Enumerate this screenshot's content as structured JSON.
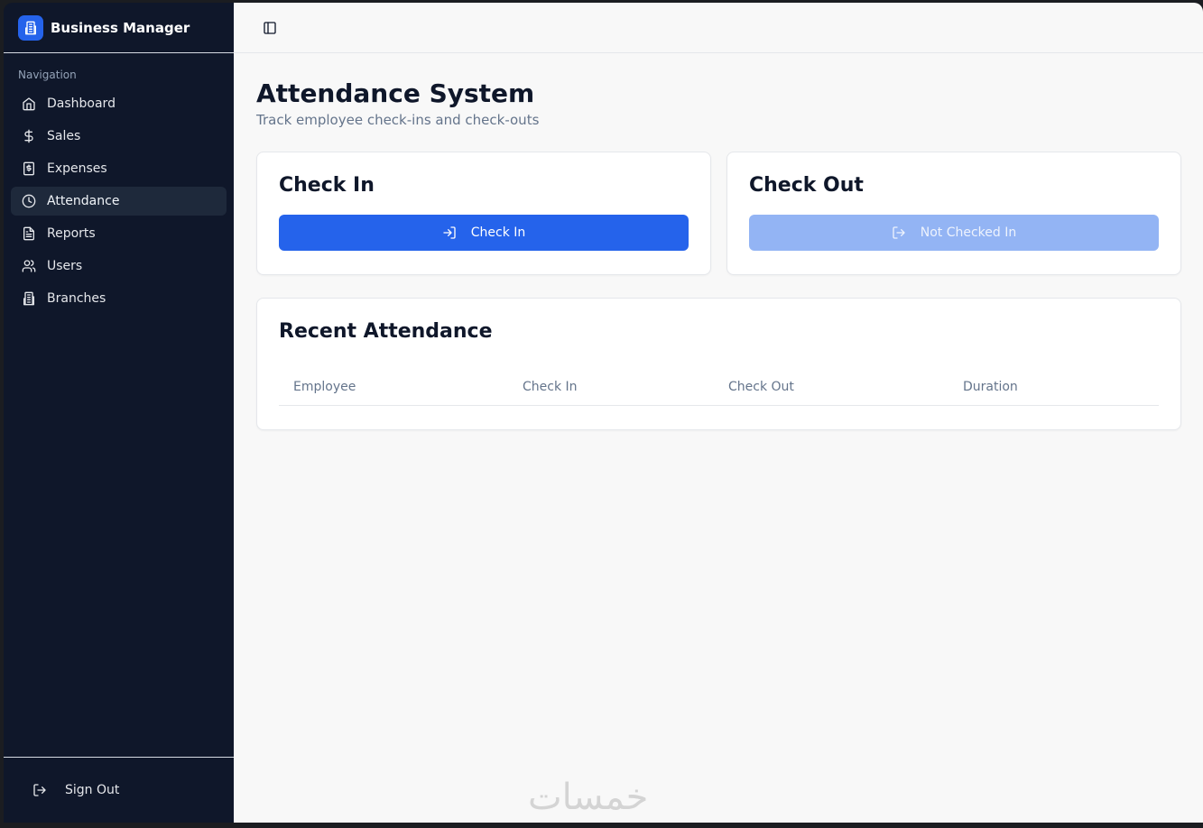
{
  "app": {
    "title": "Business Manager"
  },
  "sidebar": {
    "heading": "Navigation",
    "items": [
      {
        "label": "Dashboard",
        "icon": "home-icon"
      },
      {
        "label": "Sales",
        "icon": "dollar-icon"
      },
      {
        "label": "Expenses",
        "icon": "receipt-icon"
      },
      {
        "label": "Attendance",
        "icon": "clock-icon",
        "active": true
      },
      {
        "label": "Reports",
        "icon": "file-icon"
      },
      {
        "label": "Users",
        "icon": "users-icon"
      },
      {
        "label": "Branches",
        "icon": "building-icon"
      }
    ],
    "signout_label": "Sign Out"
  },
  "page": {
    "title": "Attendance System",
    "subtitle": "Track employee check-ins and check-outs"
  },
  "checkin_card": {
    "title": "Check In",
    "button_label": "Check In"
  },
  "checkout_card": {
    "title": "Check Out",
    "button_label": "Not Checked In"
  },
  "recent": {
    "title": "Recent Attendance",
    "columns": [
      "Employee",
      "Check In",
      "Check Out",
      "Duration"
    ]
  },
  "watermark": "خمسات",
  "colors": {
    "sidebar_bg": "#0f172a",
    "accent": "#2563eb",
    "disabled": "#93b4f4"
  }
}
